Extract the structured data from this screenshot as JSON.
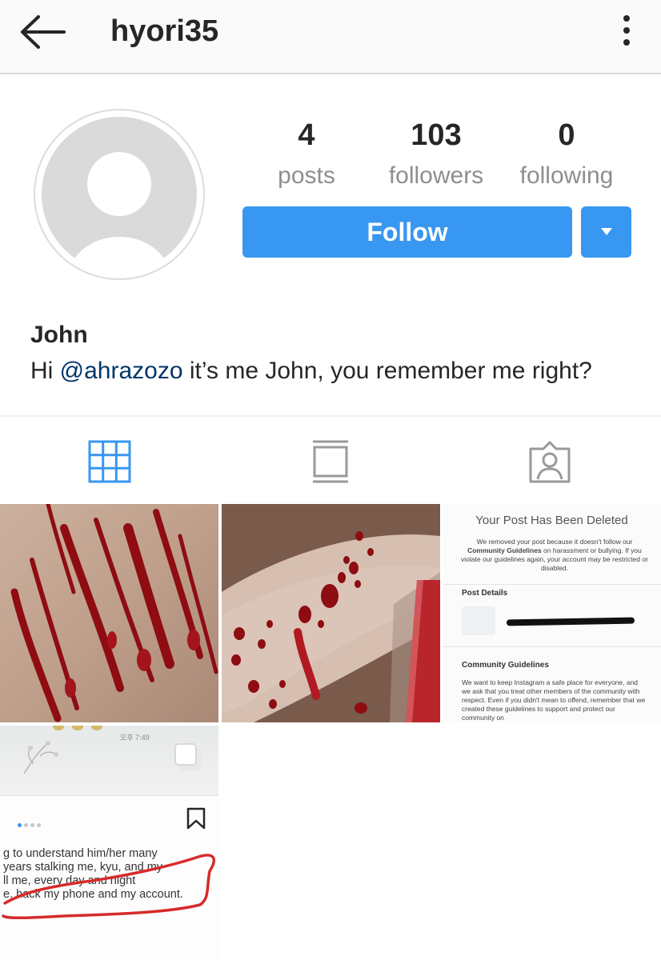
{
  "header": {
    "username": "hyori35",
    "back_icon": "back-arrow-icon",
    "more_icon": "more-vertical-icon"
  },
  "profile": {
    "avatar_icon": "default-avatar-icon",
    "stats": [
      {
        "value": "4",
        "label": "posts"
      },
      {
        "value": "103",
        "label": "followers"
      },
      {
        "value": "0",
        "label": "following"
      }
    ],
    "follow_label": "Follow",
    "dropdown_icon": "caret-down-icon",
    "display_name": "John",
    "bio_prefix": "Hi ",
    "bio_mention": "@ahrazozo",
    "bio_suffix": " it’s me John, you remember me right?"
  },
  "tabs": [
    {
      "icon": "grid-icon",
      "active": true
    },
    {
      "icon": "feed-icon",
      "active": false
    },
    {
      "icon": "tagged-icon",
      "active": false
    }
  ],
  "posts": {
    "deleted_notice": {
      "title": "Your Post Has Been Deleted",
      "body_pre": "We removed your post because it doesn't follow our ",
      "body_bold": "Community Guidelines",
      "body_post": " on harassment or bullying. If you violate our guidelines again, your account may be restricted or disabled.",
      "details_heading": "Post Details",
      "guidelines_heading": "Community Guidelines",
      "guidelines_body": "We want to keep Instagram a safe place for everyone, and we ask that you treat other members of the community with respect. Even if you didn't mean to offend, remember that we created these guidelines to support and protect our community on"
    },
    "screenshot_post": {
      "time": "오후 7:49",
      "lines": [
        "g to understand him/her many",
        " years stalking me, kyu, and my",
        "ll me, every day and night",
        "e. hack my phone and my account."
      ]
    }
  },
  "colors": {
    "accent": "#3897f0",
    "mention": "#003569",
    "annotation_circle": "#d62b2b",
    "blood": "#8e0c12"
  }
}
